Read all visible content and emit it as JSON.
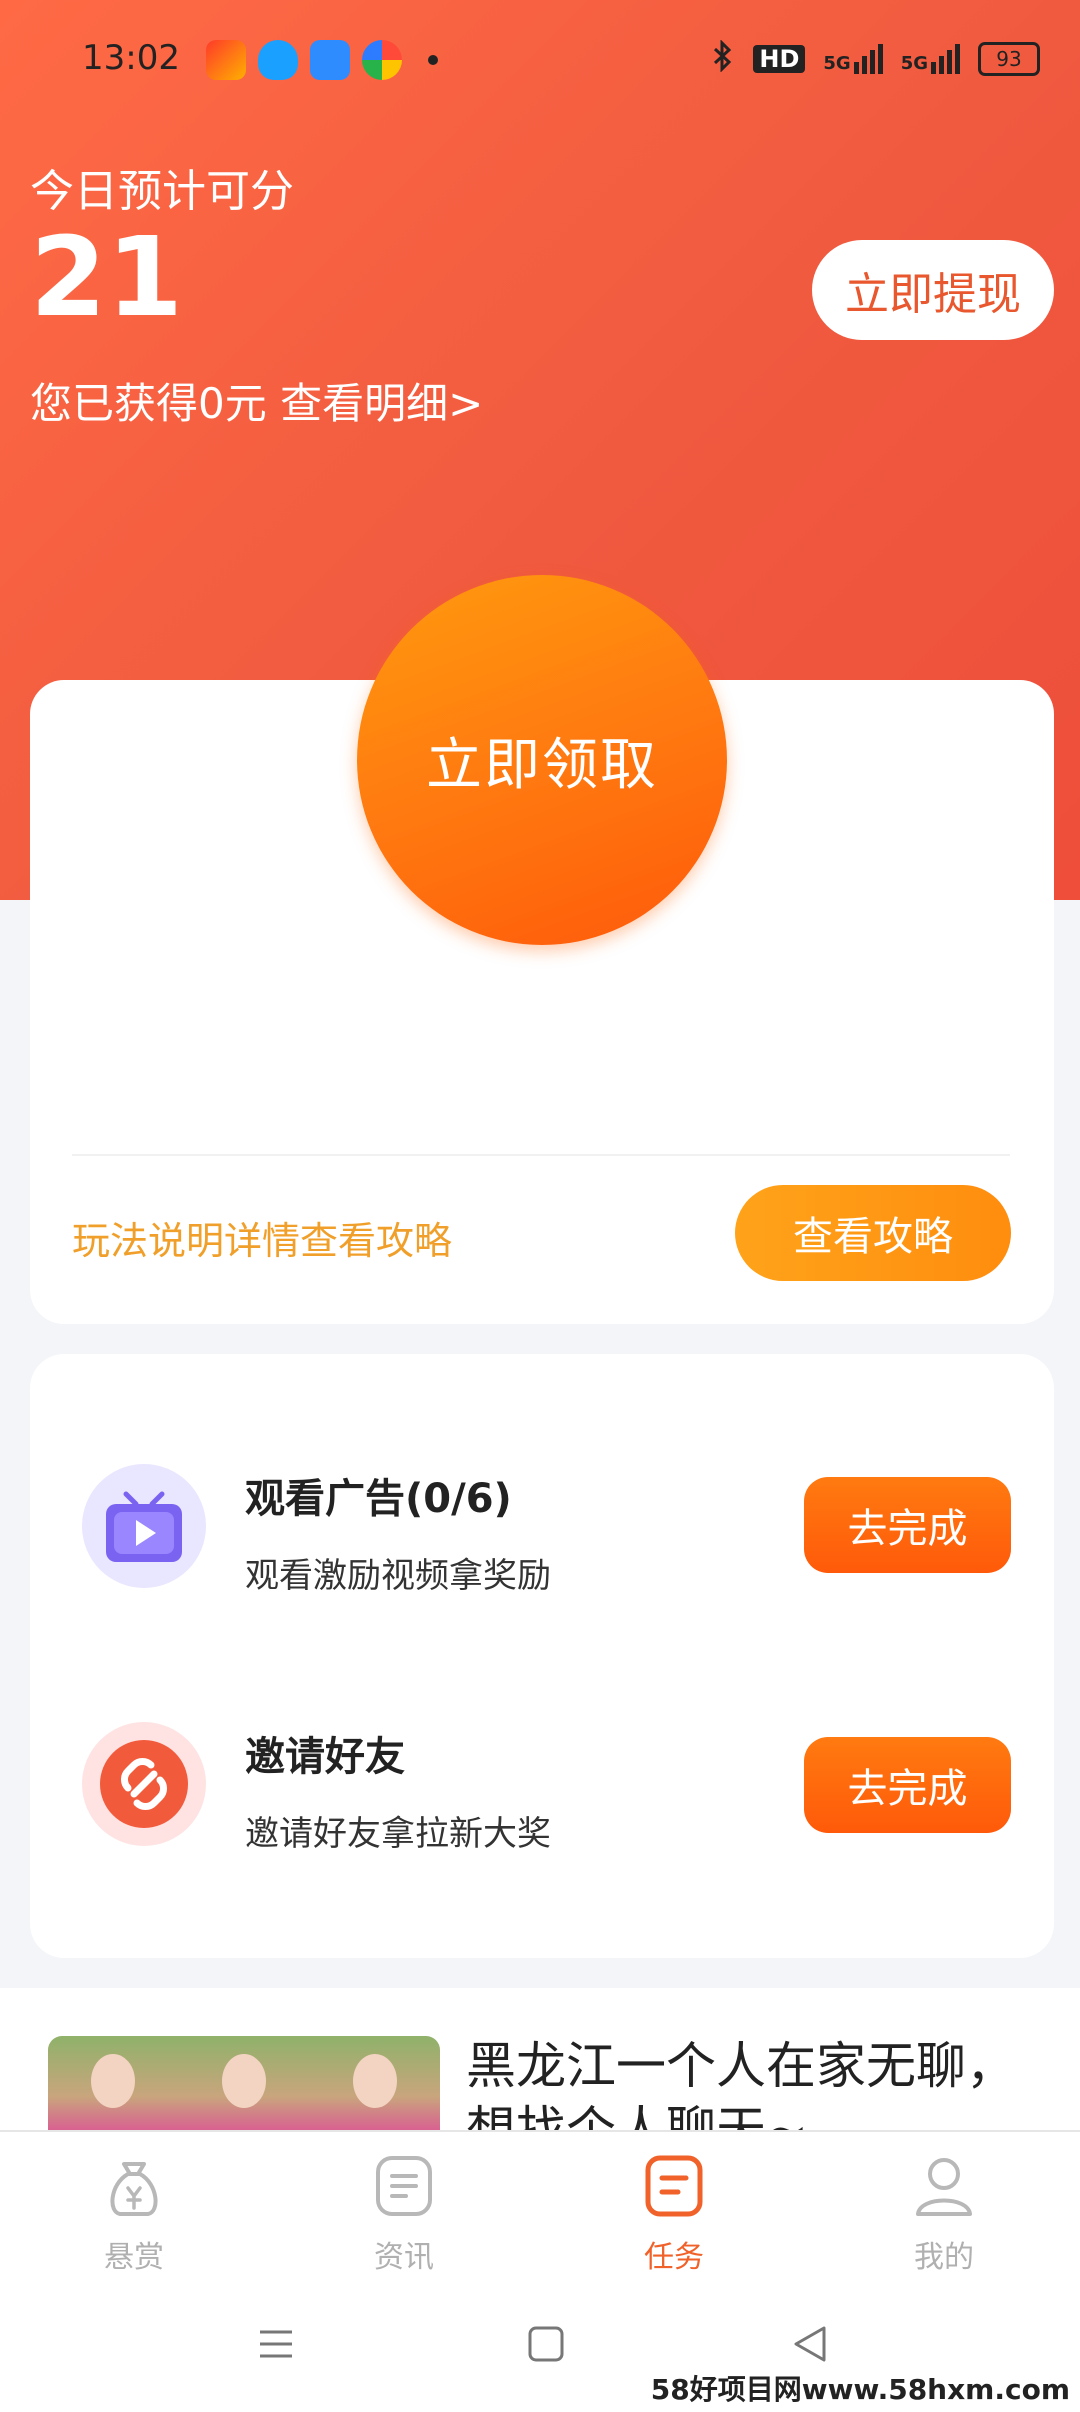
{
  "status_bar": {
    "time": "13:02",
    "hd_label": "HD",
    "signal_1": "5G",
    "signal_2": "5G",
    "battery": "93"
  },
  "header": {
    "label": "今日预计可分",
    "points": "21",
    "earned_text": "您已获得0元 查看明细>",
    "withdraw_button": "立即提现"
  },
  "claim_card": {
    "claim_button": "立即领取",
    "guide_text": "玩法说明详情查看攻略",
    "guide_button": "查看攻略"
  },
  "tasks": [
    {
      "icon": "tv-play-icon",
      "title": "观看广告(0/6)",
      "desc": "观看激励视频拿奖励",
      "button": "去完成"
    },
    {
      "icon": "link-icon",
      "title": "邀请好友",
      "desc": "邀请好友拿拉新大奖",
      "button": "去完成"
    }
  ],
  "news": {
    "title": "黑龙江一个人在家无聊，想找个人聊天~"
  },
  "tabbar": {
    "items": [
      {
        "label": "悬赏",
        "icon": "money-bag-icon"
      },
      {
        "label": "资讯",
        "icon": "news-icon"
      },
      {
        "label": "任务",
        "icon": "task-icon",
        "active": true
      },
      {
        "label": "我的",
        "icon": "user-icon"
      }
    ]
  },
  "watermark": "58好项目网www.58hxm.com",
  "colors": {
    "hero": "#f05a3f",
    "accent_orange": "#ff7a10",
    "guide_text": "#f0a02a",
    "tab_active": "#f0622a"
  }
}
